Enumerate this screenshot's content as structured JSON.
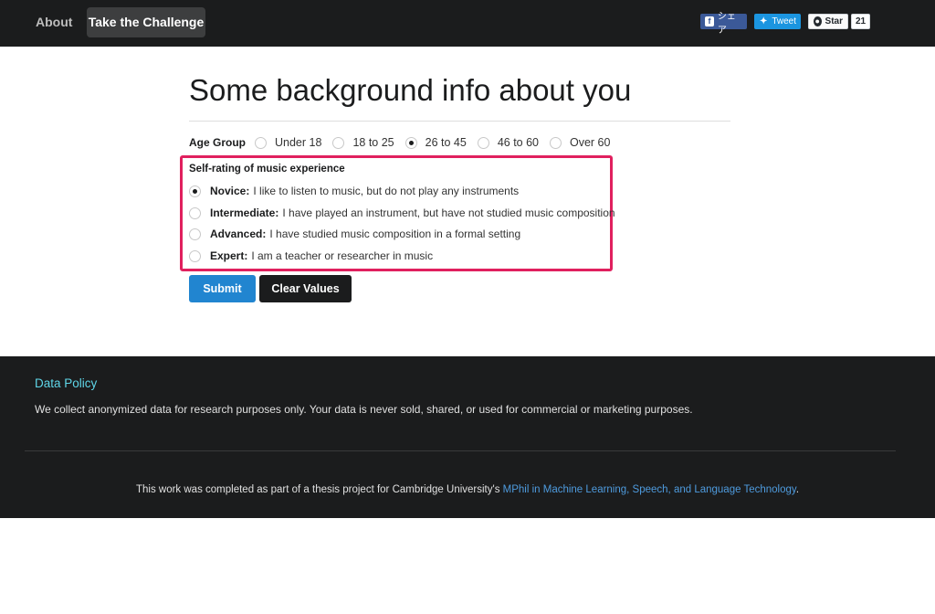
{
  "nav": {
    "about": "About",
    "challenge": "Take the Challenge"
  },
  "social": {
    "facebook_label": "シェア",
    "twitter_label": "Tweet",
    "github_label": "Star",
    "github_count": "21"
  },
  "form": {
    "title": "Some background info about you",
    "age_group": {
      "label": "Age Group",
      "options": [
        "Under 18",
        "18 to 25",
        "26 to 45",
        "46 to 60",
        "Over 60"
      ],
      "selected": "26 to 45"
    },
    "experience": {
      "heading": "Self-rating of music experience",
      "options": [
        {
          "level": "Novice:",
          "description": "I like to listen to music, but do not play any instruments"
        },
        {
          "level": "Intermediate:",
          "description": "I have played an instrument, but have not studied music composition"
        },
        {
          "level": "Advanced:",
          "description": "I have studied music composition in a formal setting"
        },
        {
          "level": "Expert:",
          "description": "I am a teacher or researcher in music"
        }
      ],
      "selected": "Novice:"
    },
    "buttons": {
      "submit": "Submit",
      "clear": "Clear Values"
    }
  },
  "footer": {
    "title": "Data Policy",
    "policy": "We collect anonymized data for research purposes only. Your data is never sold, shared, or used for commercial or marketing purposes.",
    "credit_prefix": "This work was completed as part of a thesis project for Cambridge University's ",
    "credit_link": "MPhil in Machine Learning, Speech, and Language Technology",
    "credit_suffix": "."
  },
  "colors": {
    "nav_bg": "#1b1c1d",
    "submit_blue": "#2185d0",
    "highlight_pink": "#e0205e",
    "footer_title": "#5fd6e8",
    "link_blue": "#4e9bde"
  }
}
